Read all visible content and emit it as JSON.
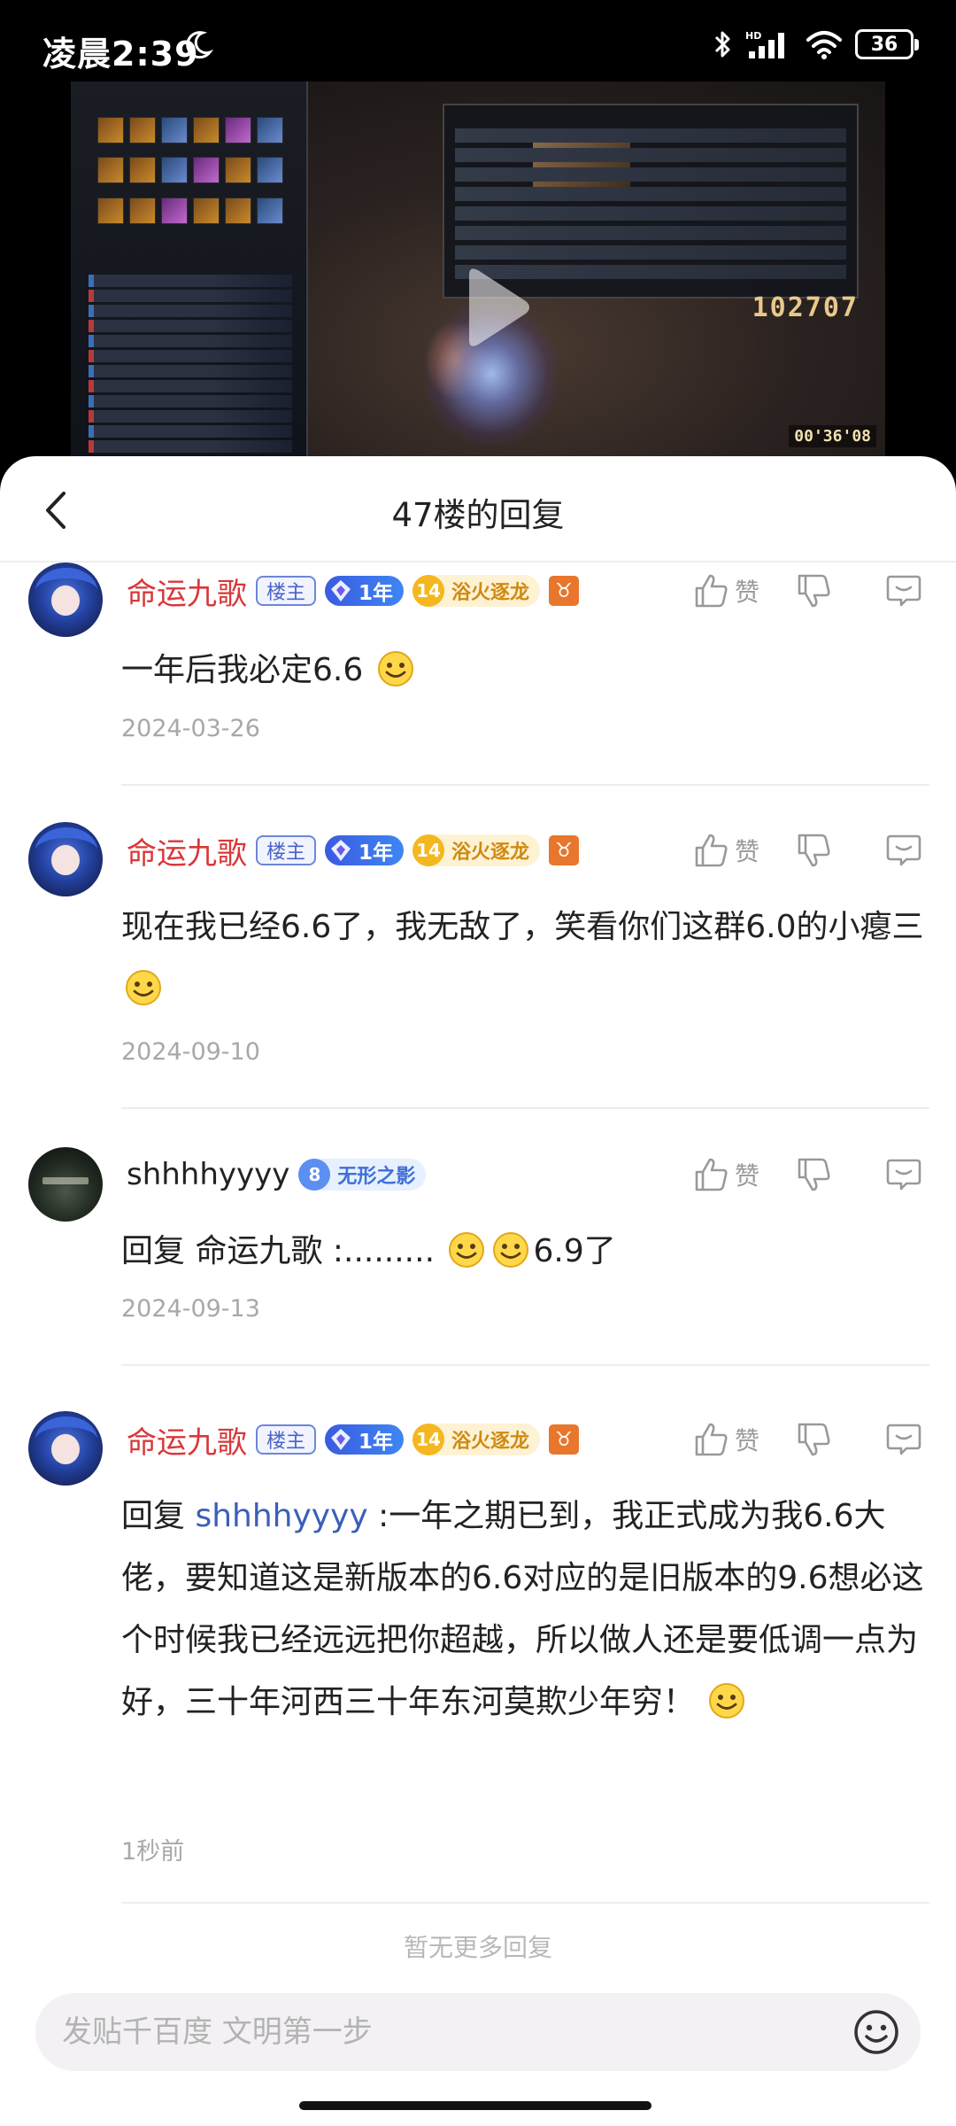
{
  "status_bar": {
    "time": "凌晨2:39",
    "icons": [
      "moon-icon",
      "bluetooth-icon",
      "hd-signal-icon",
      "wifi-icon",
      "battery-icon"
    ],
    "battery": "36"
  },
  "video": {
    "score": "102707",
    "timer": "00'36'08",
    "play_icon": "play-icon"
  },
  "sheet": {
    "title": "47楼的回复",
    "back_icon": "chevron-left-icon"
  },
  "replies": [
    {
      "user": "命运九歌",
      "owner_badge": "楼主",
      "year_badge": "1年",
      "level": "14",
      "level_title": "浴火逐龙",
      "zodiac": "♉",
      "like_label": "赞",
      "text": "一年后我必定6.6",
      "date": "2024-03-26"
    },
    {
      "user": "命运九歌",
      "owner_badge": "楼主",
      "year_badge": "1年",
      "level": "14",
      "level_title": "浴火逐龙",
      "zodiac": "♉",
      "like_label": "赞",
      "text": "现在我已经6.6了，我无敌了，笑看你们这群6.0的小瘪三",
      "date": "2024-09-10"
    },
    {
      "user": "shhhhyyyy",
      "level": "8",
      "level_title": "无形之影",
      "like_label": "赞",
      "text_a": "回复 命运九歌 :.........",
      "text_b": "6.9了",
      "date": "2024-09-13"
    },
    {
      "user": "命运九歌",
      "owner_badge": "楼主",
      "year_badge": "1年",
      "level": "14",
      "level_title": "浴火逐龙",
      "zodiac": "♉",
      "like_label": "赞",
      "text_prefix": "回复 ",
      "mention": "shhhhyyyy",
      "text": " :一年之期已到，我正式成为我6.6大佬，要知道这是新版本的6.6对应的是旧版本的9.6想必这个时候我已经远远把你超越，所以做人还是要低调一点为好，三十年河西三十年东河莫欺少年穷！",
      "date": "1秒前"
    }
  ],
  "footer": {
    "no_more": "暂无更多回复",
    "composer_placeholder": "发贴千百度 文明第一步",
    "emoji_button_icon": "smile-icon"
  },
  "colors": {
    "username_owner": "#d9383a",
    "mention": "#3b5fb8",
    "owner_badge": "#4b63c6",
    "year_badge": "#3a5be0",
    "level_badge": "#f4b71f",
    "zodiac_badge": "#e8762c"
  }
}
